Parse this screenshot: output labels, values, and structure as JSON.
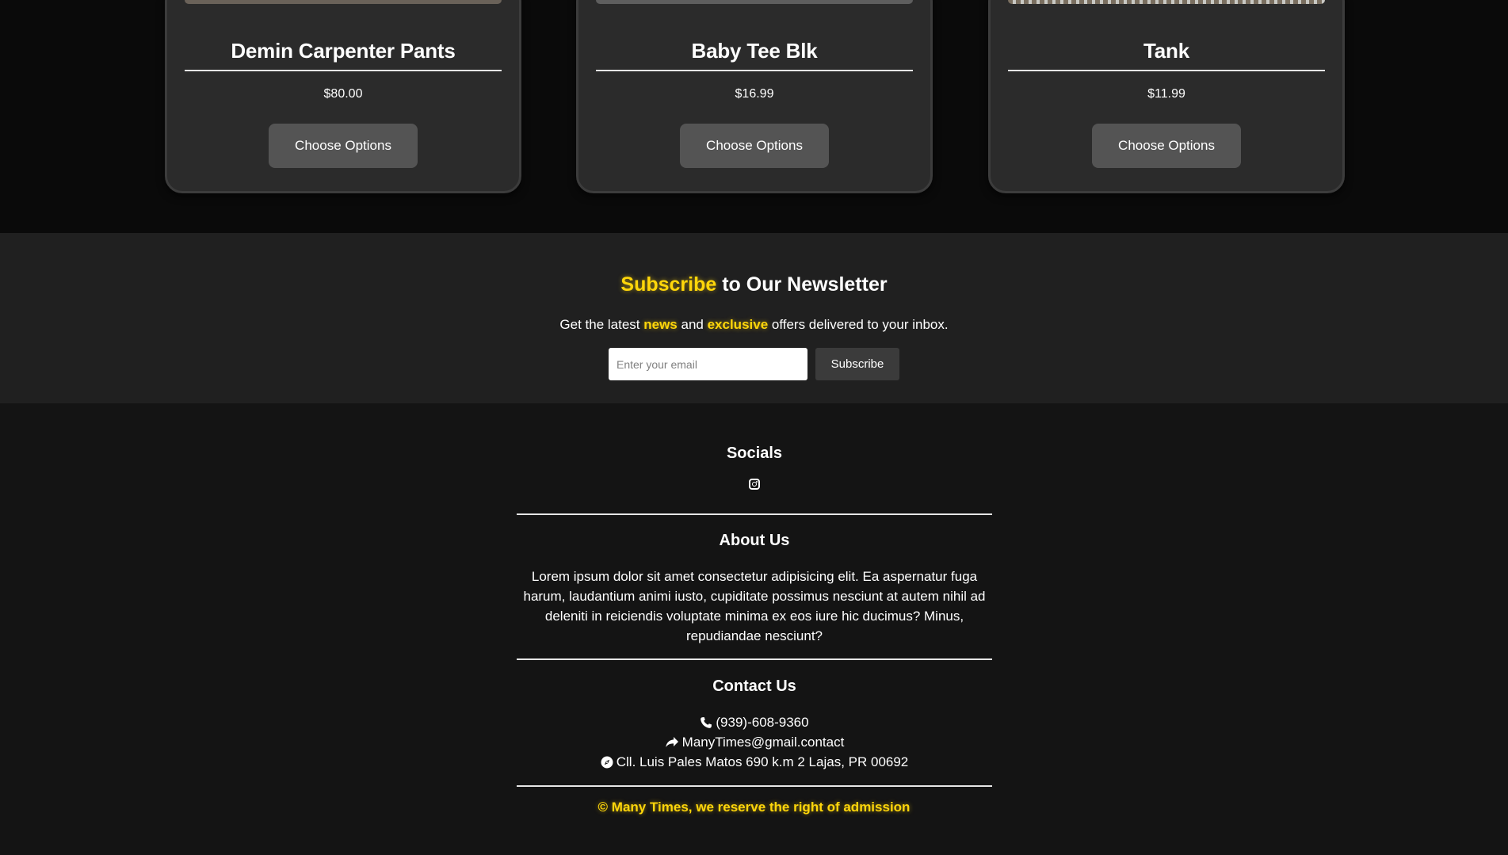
{
  "products": [
    {
      "name": "Demin Carpenter Pants",
      "price": "$80.00",
      "button_label": "Choose Options"
    },
    {
      "name": "Baby Tee Blk",
      "price": "$16.99",
      "button_label": "Choose Options"
    },
    {
      "name": "Tank",
      "price": "$11.99",
      "button_label": "Choose Options"
    }
  ],
  "newsletter": {
    "title_highlight": "Subscribe",
    "title_rest": " to Our Newsletter",
    "lead_prefix": "Get the latest ",
    "lead_hl1": "news",
    "lead_mid": " and ",
    "lead_hl2": "exclusive",
    "lead_suffix": " offers delivered to your inbox.",
    "email_placeholder": "Enter your email",
    "email_value": "",
    "button_label": "Subscribe"
  },
  "footer": {
    "socials_title": "Socials",
    "about_title": "About Us",
    "about_text": "Lorem ipsum dolor sit amet consectetur adipisicing elit. Ea aspernatur fuga harum, laudantium animi iusto, cupiditate possimus nesciunt at autem nihil ad deleniti in reiciendis voluptate minima ex eos iure hic ducimus? Minus, repudiandae nesciunt?",
    "contact_title": "Contact Us",
    "phone": "(939)-608-9360",
    "email": "ManyTimes@gmail.contact",
    "address": "Cll. Luis Pales Matos 690 k.m 2 Lajas, PR 00692",
    "copyright": "© Many Times, we reserve the right of admission"
  },
  "colors": {
    "accent": "#ffd60a",
    "page_bg": "#0a0a0a",
    "card_bg": "#2b2b2b",
    "newsletter_bg": "#202020",
    "footer_bg": "#141414"
  },
  "icons": [
    "instagram-icon",
    "phone-icon",
    "share-arrow-icon",
    "compass-icon"
  ]
}
